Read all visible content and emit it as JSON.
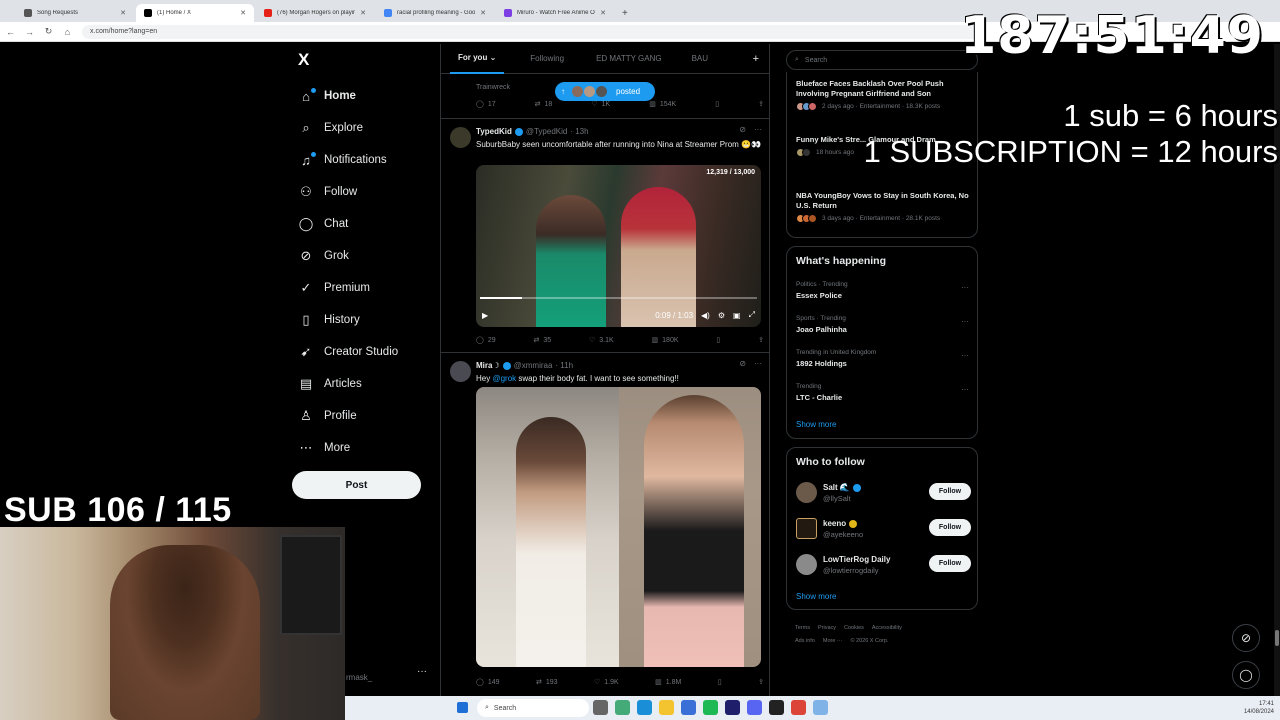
{
  "browser": {
    "tabs": [
      {
        "title": "Song Requests"
      },
      {
        "title": "(1) Home / X"
      },
      {
        "title": "(76) Morgan Rogers on playing..."
      },
      {
        "title": "racial profiling meaning - Goog..."
      },
      {
        "title": "Miruro - Watch Free Anime Onl..."
      }
    ],
    "url": "x.com/home?lang=en"
  },
  "nav": {
    "logo": "X",
    "items": [
      {
        "label": "Home",
        "icon": "home-icon"
      },
      {
        "label": "Explore",
        "icon": "search-icon"
      },
      {
        "label": "Notifications",
        "icon": "bell-icon"
      },
      {
        "label": "Follow",
        "icon": "person-add-icon"
      },
      {
        "label": "Chat",
        "icon": "chat-icon"
      },
      {
        "label": "Grok",
        "icon": "grok-icon"
      },
      {
        "label": "Premium",
        "icon": "premium-icon"
      },
      {
        "label": "History",
        "icon": "bookmark-icon"
      },
      {
        "label": "Creator Studio",
        "icon": "rocket-icon"
      },
      {
        "label": "Articles",
        "icon": "articles-icon"
      },
      {
        "label": "Profile",
        "icon": "profile-icon"
      },
      {
        "label": "More",
        "icon": "more-icon"
      }
    ],
    "post_label": "Post",
    "account_handle": "rmask_"
  },
  "timeline": {
    "tabs": [
      "For you",
      "Following",
      "ED MATTY GANG",
      "BAU"
    ],
    "posted_pill": "posted",
    "prev_tweet": {
      "snippet": "Trainwreck",
      "replies": "17",
      "reposts": "18",
      "likes": "1K",
      "views": "154K"
    },
    "tweet1": {
      "name": "TypedKid",
      "handle": "@TypedKid",
      "time": "· 13h",
      "text": "SuburbBaby seen uncomfortable after running into Nina at Streamer Prom 😬👀",
      "view_count": "12,319 / 13,000",
      "video_time": "0:09 / 1:03",
      "video_progress": 0.15,
      "replies": "29",
      "reposts": "35",
      "likes": "3.1K",
      "views": "180K"
    },
    "tweet2": {
      "name": "Mira☽",
      "handle": "@xmmiraa",
      "time": "· 11h",
      "text_prefix": "Hey ",
      "mention": "@grok",
      "text_suffix": " swap their body fat. I want to see something!!",
      "replies": "149",
      "reposts": "193",
      "likes": "1.9K",
      "views": "1.8M"
    }
  },
  "sidebar": {
    "search_placeholder": "Search",
    "news": [
      {
        "title": "Blueface Faces Backlash Over Pool Push Involving Pregnant Girlfriend and Son",
        "meta": "2 days ago · Entertainment · 18.3K posts"
      },
      {
        "title": "Funny Mike's Stre... Glamour and Dram...",
        "meta": "18 hours ago"
      },
      {
        "title": "NBA YoungBoy Vows to Stay in South Korea, No U.S. Return",
        "meta": "3 days ago · Entertainment · 28.1K posts"
      }
    ],
    "happening_title": "What's happening",
    "trends": [
      {
        "context": "Politics · Trending",
        "name": "Essex Police"
      },
      {
        "context": "Sports · Trending",
        "name": "Joao Palhinha"
      },
      {
        "context": "Trending in United Kingdom",
        "name": "1892 Holdings"
      },
      {
        "context": "Trending",
        "name": "LTC - Charlie"
      }
    ],
    "show_more": "Show more",
    "wtf_title": "Who to follow",
    "who_to_follow": [
      {
        "name": "Salt 🌊",
        "handle": "@llySalt"
      },
      {
        "name": "keeno",
        "handle": "@ayekeeno"
      },
      {
        "name": "LowTierRog Daily",
        "handle": "@lowtierrogdaily"
      }
    ],
    "follow_label": "Follow",
    "footer": [
      "Terms",
      "Privacy",
      "Cookies",
      "Accessibility",
      "Ads info",
      "More ···",
      "© 2026 X Corp."
    ]
  },
  "overlay": {
    "timer": "187:51:49",
    "line1": "1 sub = 6 hours",
    "line2": "1 SUBSCRIPTION = 12 hours",
    "sub_count": "SUB 106 / 115"
  },
  "taskbar": {
    "search_label": "Search",
    "time": "17:41",
    "date": "14/08/2024"
  }
}
